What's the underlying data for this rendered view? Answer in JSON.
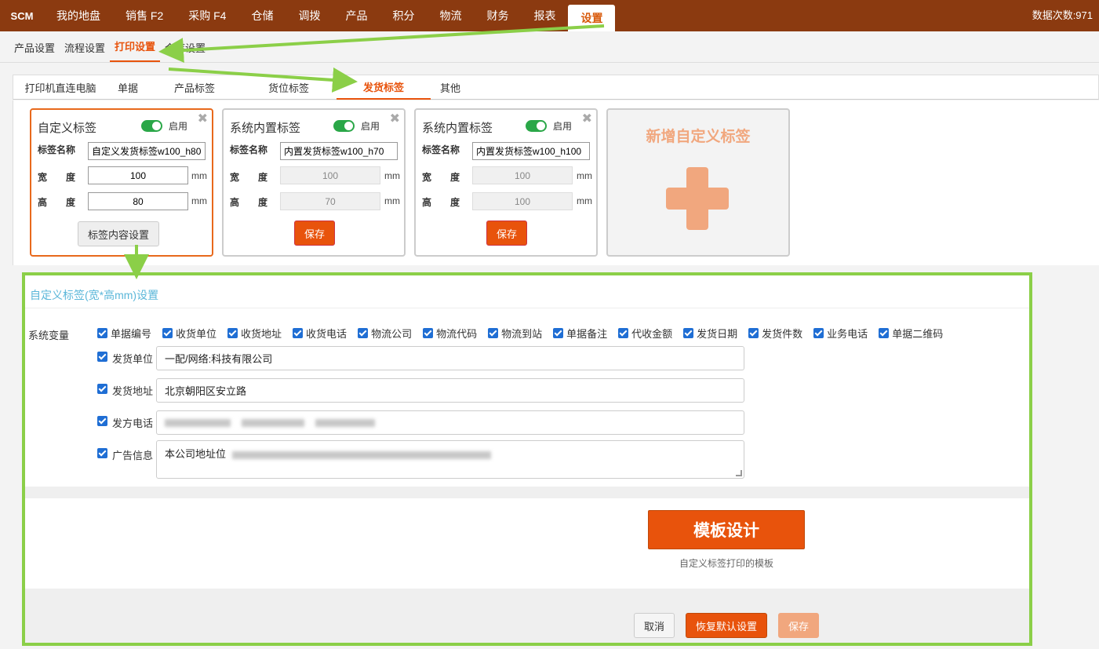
{
  "topbar": {
    "brand": "SCM",
    "items": [
      "我的地盘",
      "销售 F2",
      "采购 F4",
      "仓储",
      "调拨",
      "产品",
      "积分",
      "物流",
      "财务",
      "报表",
      "设置"
    ],
    "active_index": 10,
    "data_count": "数据次数:971"
  },
  "subnav": {
    "items": [
      "产品设置",
      "流程设置",
      "打印设置",
      "仓库设置"
    ],
    "active_index": 2
  },
  "tabs": {
    "items": [
      "打印机直连电脑",
      "单据",
      "产品标签",
      "货位标签",
      "发货标签",
      "其他"
    ],
    "active_index": 4
  },
  "cards": [
    {
      "title": "自定义标签",
      "toggle_label": "启用",
      "enabled": true,
      "name_label": "标签名称",
      "name_value": "自定义发货标签w100_h80",
      "width_label": "宽　　度",
      "width_value": "100",
      "height_label": "高　　度",
      "height_value": "80",
      "unit": "mm",
      "button": "标签内容设置"
    },
    {
      "title": "系统内置标签",
      "toggle_label": "启用",
      "enabled": true,
      "name_label": "标签名称",
      "name_value": "内置发货标签w100_h70",
      "width_label": "宽　　度",
      "width_value": "100",
      "height_label": "高　　度",
      "height_value": "70",
      "unit": "mm",
      "button": "保存"
    },
    {
      "title": "系统内置标签",
      "toggle_label": "启用",
      "enabled": true,
      "name_label": "标签名称",
      "name_value": "内置发货标签w100_h100",
      "width_label": "宽　　度",
      "width_value": "100",
      "height_label": "高　　度",
      "height_value": "100",
      "unit": "mm",
      "button": "保存"
    }
  ],
  "add_card": {
    "title": "新增自定义标签"
  },
  "panel": {
    "title": "自定义标签(宽*高mm)设置",
    "sysvar_label": "系统变量",
    "variables": [
      "单据编号",
      "收货单位",
      "收货地址",
      "收货电话",
      "物流公司",
      "物流代码",
      "物流到站",
      "单据备注",
      "代收金额",
      "发货日期",
      "发货件数",
      "业务电话",
      "单据二维码"
    ],
    "fields": [
      {
        "label": "发货单位",
        "value": "一配/网络:科技有限公司"
      },
      {
        "label": "发货地址",
        "value": "北京朝阳区安立路"
      },
      {
        "label": "发方电话",
        "value": ""
      },
      {
        "label": "广告信息",
        "value": "本公司地址位"
      }
    ],
    "template_button": "模板设计",
    "template_note": "自定义标签打印的模板",
    "cancel": "取消",
    "reset": "恢复默认设置",
    "save": "保存"
  },
  "colors": {
    "topbar": "#8b3a10",
    "accent": "#e8530c",
    "highlight": "#8bcf48",
    "link": "#5bb7d9"
  }
}
